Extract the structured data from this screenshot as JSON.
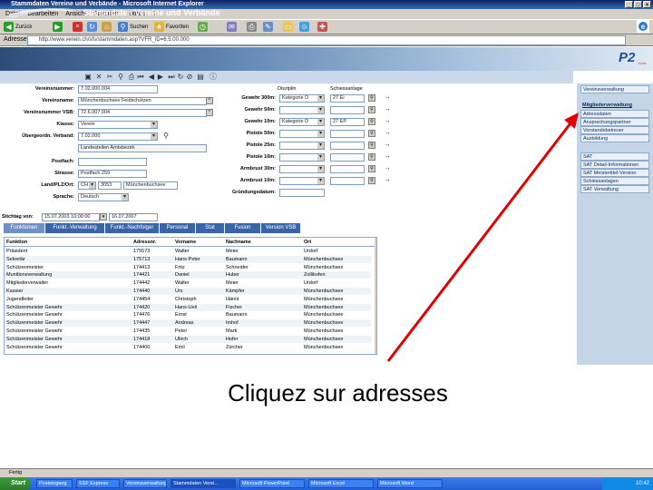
{
  "window": {
    "title": "Stammdaten Vereine und Verbände - Microsoft Internet Explorer"
  },
  "browser": {
    "menu": [
      "Datei",
      "Bearbeiten",
      "Ansicht",
      "Favoriten",
      "Extras",
      "?"
    ],
    "toolbar": {
      "back": "Zurück",
      "search": "Suchen",
      "favorites": "Favoriten"
    },
    "address_label": "Adresse",
    "address_value": "http://www.verein.ch/sfs/stammdaten.asp?VFR_ID=6.5.00.000"
  },
  "app": {
    "title": "Stammdaten Vereine und Verbände",
    "logo": "P2",
    "logo_sub": "tools"
  },
  "form": {
    "fields": [
      {
        "label": "Vereinsnummer:",
        "value": "7.02.000.004"
      },
      {
        "label": "Vereinsname:",
        "value": "Münchenbuchsee Feldschützen"
      },
      {
        "label": "Vereinsnummer VSB:",
        "value": "72.6.007.004"
      },
      {
        "label": "Klasse:",
        "value": "Verein"
      },
      {
        "label": "Übergeordn. Verband:",
        "value": "7.02.000"
      },
      {
        "label": "",
        "value": "Landesteilen Amtsbezirk"
      },
      {
        "label": "Postfach:",
        "value": ""
      },
      {
        "label": "Strasse:",
        "value": "Postfach 259"
      },
      {
        "label": "Land/PLZ/Ort:",
        "value": "CH"
      },
      {
        "label": "Sprache:",
        "value": "Deutsch"
      }
    ],
    "plz": "3053",
    "ort": "Münchenbuchsee",
    "distances_header": {
      "disziplin": "Disziplin",
      "schiessanlage": "Schiessanlage"
    },
    "distances": [
      {
        "label": "Gewehr 300m:",
        "disziplin": "Kategorie D",
        "anlage": "27 Ei"
      },
      {
        "label": "Gewehr 50m:",
        "disziplin": "",
        "anlage": ""
      },
      {
        "label": "Gewehr 10m:",
        "disziplin": "Kategorie D",
        "anlage": "27 EP"
      },
      {
        "label": "Pistole 50m:",
        "disziplin": "",
        "anlage": ""
      },
      {
        "label": "Pistole 25m:",
        "disziplin": "",
        "anlage": ""
      },
      {
        "label": "Pistole 10m:",
        "disziplin": "",
        "anlage": ""
      },
      {
        "label": "Armbrust 30m:",
        "disziplin": "",
        "anlage": ""
      },
      {
        "label": "Armbrust 10m:",
        "disziplin": "",
        "anlage": ""
      },
      {
        "label": "Gründungsdatum:",
        "disziplin": "",
        "anlage": ""
      }
    ],
    "stichtag_label": "Stichtag von:",
    "stichtag_from": "15.07.2003 10:00:00",
    "stichtag_to": "16.07.2007"
  },
  "rightnav": {
    "header1": "Vereinsverwaltung",
    "header2": "Mitgliederverwaltung",
    "items1": [
      "Adressdaten",
      "Ansprechungspartner",
      "Vorstandsbetreuer",
      "Ausbildung"
    ],
    "items2": [
      "SAT",
      "SAT Detail-Informationen",
      "SAT Meistertitel-Version",
      "Schiessanlagen",
      "SAT Verwaltung"
    ]
  },
  "tabs": [
    "Funktionen",
    "Funkt.-Verwaltung",
    "Funkt.-Nachfolger",
    "Personal",
    "Stat",
    "Fusion",
    "Version VSB"
  ],
  "table": {
    "columns": [
      "Funktion",
      "Adressnr.",
      "Vorname",
      "Nachname",
      "Ort"
    ],
    "rows": [
      [
        "Präsident",
        "175573",
        "Walter",
        "Meier",
        "Urdorf"
      ],
      [
        "Sekretär",
        "175713",
        "Hans-Peter",
        "Baumann",
        "Münchenbuchsee"
      ],
      [
        "Schützenmeister",
        "174413",
        "Fritz",
        "Schneider",
        "Münchenbuchsee"
      ],
      [
        "Munitionsverwaltung",
        "174421",
        "Daniel",
        "Huber",
        "Zollikofen"
      ],
      [
        "Mitgliederverwalter",
        "174442",
        "Walter",
        "Meier",
        "Urdorf"
      ],
      [
        "Kassier",
        "174440",
        "Urs",
        "Kämpfer",
        "Münchenbuchsee"
      ],
      [
        "Jugendleiter",
        "174454",
        "Christoph",
        "Hänni",
        "Münchenbuchsee"
      ],
      [
        "Schützenmeister Gewehr",
        "174420",
        "Hans-Ueli",
        "Fischer",
        "Münchenbuchsee"
      ],
      [
        "Schützenmeister Gewehr",
        "174476",
        "Ernst",
        "Baumann",
        "Münchenbuchsee"
      ],
      [
        "Schützenmeister Gewehr",
        "174447",
        "Andreas",
        "Imhof",
        "Münchenbuchsee"
      ],
      [
        "Schützenmeister Gewehr",
        "174435",
        "Peter",
        "Marti",
        "Münchenbuchsee"
      ],
      [
        "Schützenmeister Gewehr",
        "174418",
        "Ulrich",
        "Hofer",
        "Münchenbuchsee"
      ],
      [
        "Schützenmeister Gewehr",
        "174400",
        "Emil",
        "Zürcher",
        "Münchenbuchsee"
      ]
    ]
  },
  "caption": "Cliquez sur adresses",
  "statusbar": "Fertig",
  "taskbar": {
    "start": "Start",
    "tasks": [
      "Posteingang",
      "SSF Express",
      "Vereinsverwaltung",
      "Stammdaten Verei...",
      "Microsoft PowerPoint",
      "Microsoft Excel",
      "Microsoft Word"
    ],
    "clock": "10:42"
  },
  "colors": {
    "accent": "#3a64a8",
    "arrow": "#e00000"
  }
}
